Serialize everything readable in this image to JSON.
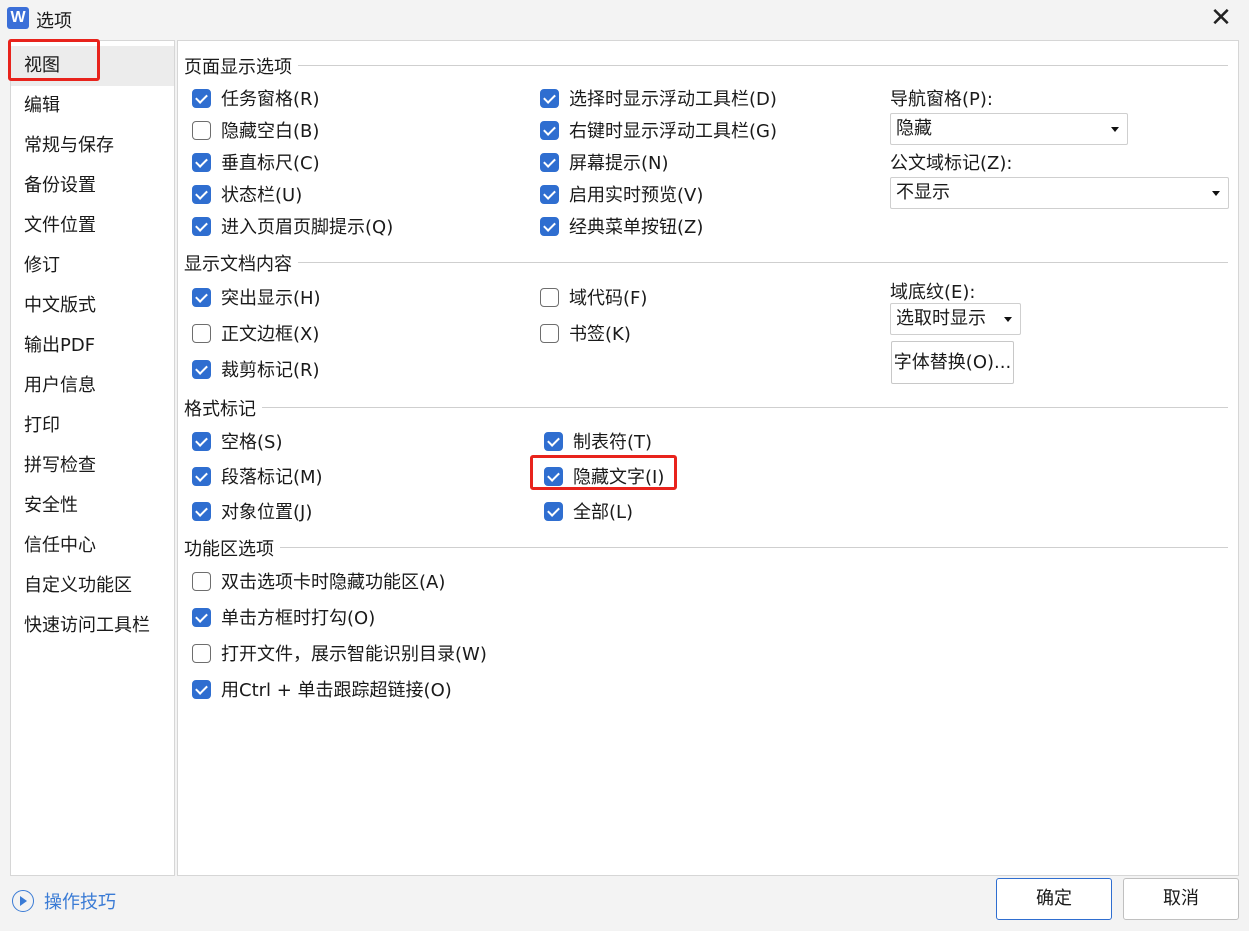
{
  "window": {
    "title": "选项",
    "app_icon_letter": "W"
  },
  "sidebar": {
    "items": [
      {
        "label": "视图",
        "selected": true
      },
      {
        "label": "编辑"
      },
      {
        "label": "常规与保存"
      },
      {
        "label": "备份设置"
      },
      {
        "label": "文件位置"
      },
      {
        "label": "修订"
      },
      {
        "label": "中文版式"
      },
      {
        "label": "输出PDF"
      },
      {
        "label": "用户信息"
      },
      {
        "label": "打印"
      },
      {
        "label": "拼写检查"
      },
      {
        "label": "安全性"
      },
      {
        "label": "信任中心"
      },
      {
        "label": "自定义功能区"
      },
      {
        "label": "快速访问工具栏"
      }
    ]
  },
  "sections": {
    "page_display": {
      "title": "页面显示选项",
      "col1": [
        {
          "label": "任务窗格(R)",
          "checked": true
        },
        {
          "label": "隐藏空白(B)",
          "checked": false
        },
        {
          "label": "垂直标尺(C)",
          "checked": true
        },
        {
          "label": "状态栏(U)",
          "checked": true
        },
        {
          "label": "进入页眉页脚提示(Q)",
          "checked": true
        }
      ],
      "col2": [
        {
          "label": "选择时显示浮动工具栏(D)",
          "checked": true
        },
        {
          "label": "右键时显示浮动工具栏(G)",
          "checked": true
        },
        {
          "label": "屏幕提示(N)",
          "checked": true
        },
        {
          "label": "启用实时预览(V)",
          "checked": true
        },
        {
          "label": "经典菜单按钮(Z)",
          "checked": true
        }
      ],
      "nav_pane_label": "导航窗格(P):",
      "nav_pane_value": "隐藏",
      "doc_field_label": "公文域标记(Z):",
      "doc_field_value": "不显示"
    },
    "doc_content": {
      "title": "显示文档内容",
      "col1": [
        {
          "label": "突出显示(H)",
          "checked": true
        },
        {
          "label": "正文边框(X)",
          "checked": false
        },
        {
          "label": "裁剪标记(R)",
          "checked": true
        }
      ],
      "col2": [
        {
          "label": "域代码(F)",
          "checked": false
        },
        {
          "label": "书签(K)",
          "checked": false
        }
      ],
      "field_shading_label": "域底纹(E):",
      "field_shading_value": "选取时显示",
      "font_sub_button": "字体替换(O)..."
    },
    "format_marks": {
      "title": "格式标记",
      "col1": [
        {
          "label": "空格(S)",
          "checked": true
        },
        {
          "label": "段落标记(M)",
          "checked": true
        },
        {
          "label": "对象位置(J)",
          "checked": true
        }
      ],
      "col2": [
        {
          "label": "制表符(T)",
          "checked": true
        },
        {
          "label": "隐藏文字(I)",
          "checked": true
        },
        {
          "label": "全部(L)",
          "checked": true
        }
      ]
    },
    "ribbon": {
      "title": "功能区选项",
      "items": [
        {
          "label": "双击选项卡时隐藏功能区(A)",
          "checked": false
        },
        {
          "label": "单击方框时打勾(O)",
          "checked": true
        },
        {
          "label": "打开文件，展示智能识别目录(W)",
          "checked": false
        },
        {
          "label": "用Ctrl + 单击跟踪超链接(O)",
          "checked": true
        }
      ]
    }
  },
  "footer": {
    "tips_label": "操作技巧",
    "ok_label": "确定",
    "cancel_label": "取消"
  },
  "colors": {
    "accent": "#2f6ed0",
    "highlight": "#e8231c",
    "link": "#3a7bd5"
  }
}
